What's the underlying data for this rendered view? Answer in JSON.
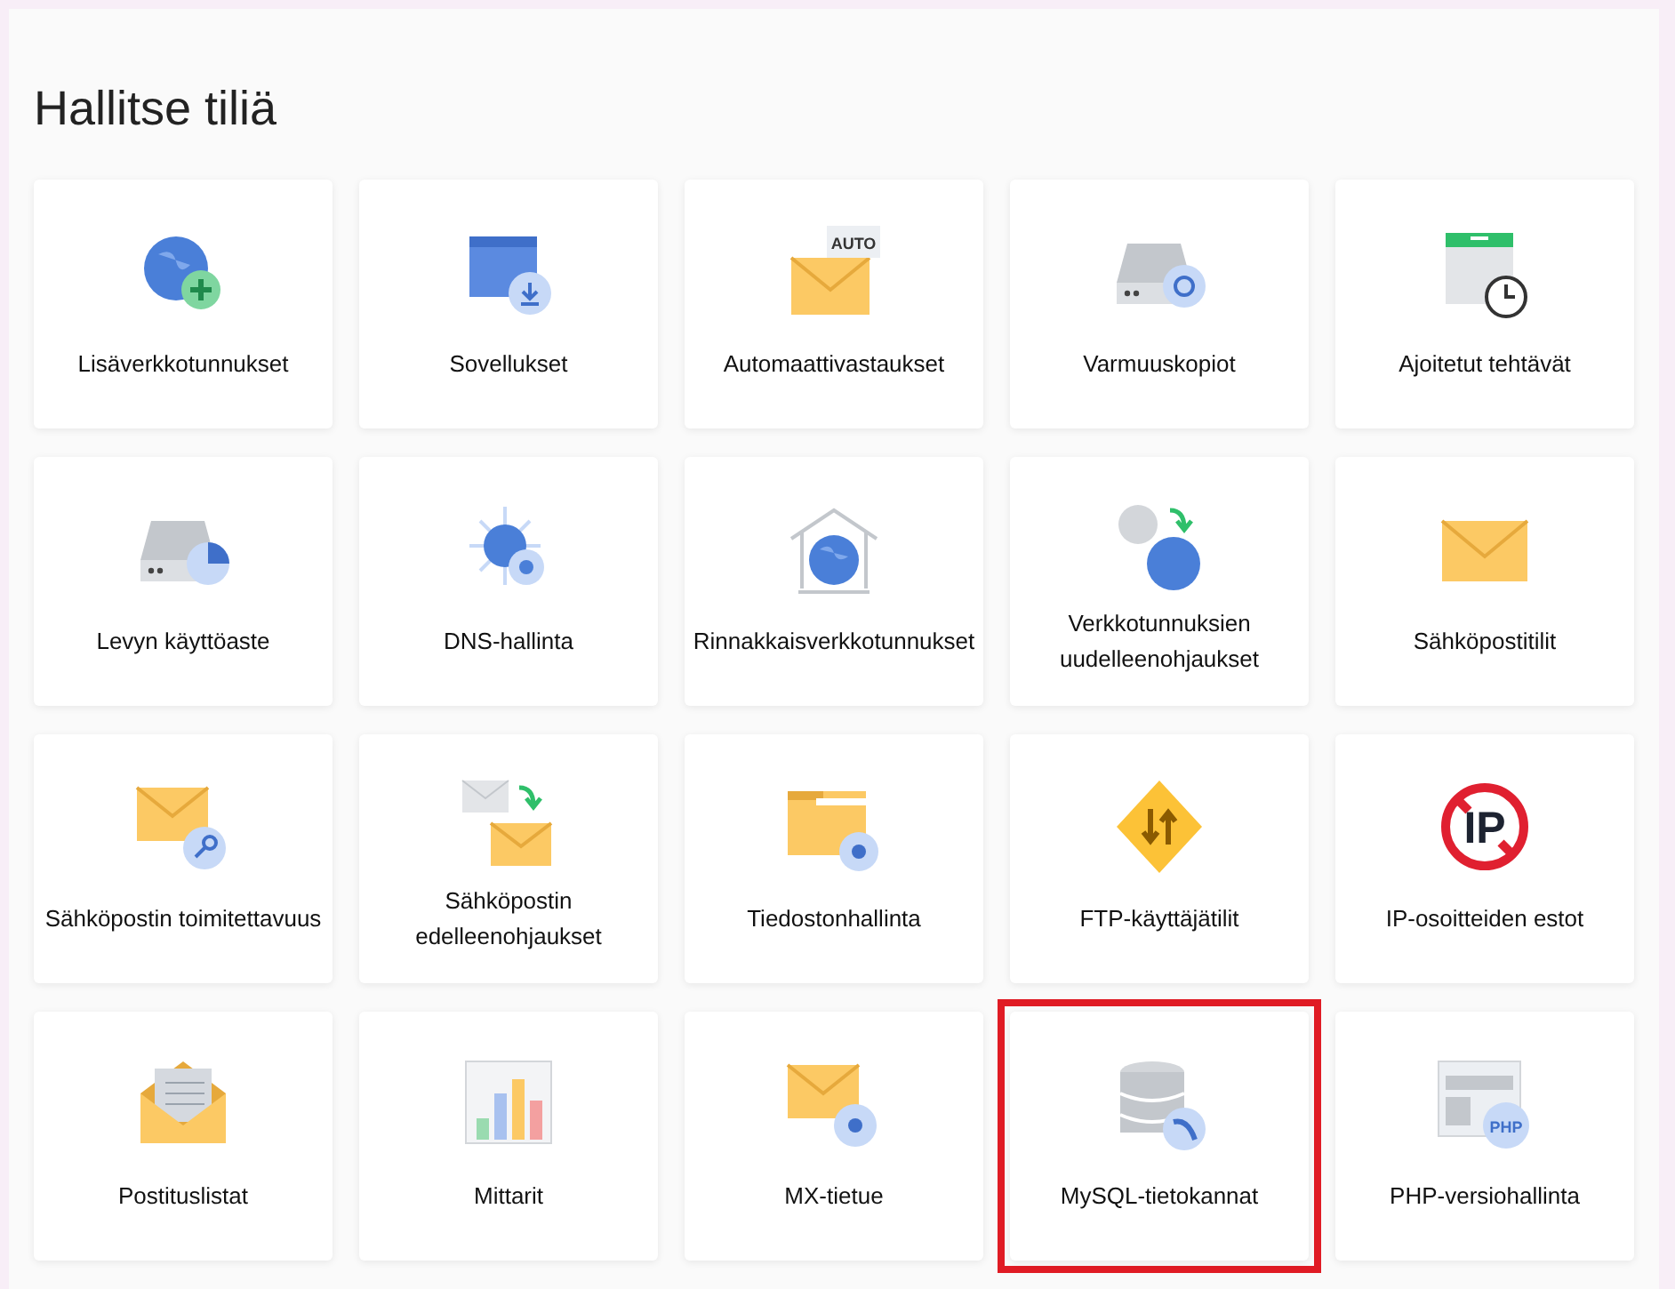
{
  "title": "Hallitse tiliä",
  "tiles": [
    {
      "label": "Lisäverkkotunnukset",
      "highlighted": false
    },
    {
      "label": "Sovellukset",
      "highlighted": false
    },
    {
      "label": "Automaattivastaukset",
      "highlighted": false,
      "icon_text": "AUTO"
    },
    {
      "label": "Varmuuskopiot",
      "highlighted": false
    },
    {
      "label": "Ajoitetut tehtävät",
      "highlighted": false
    },
    {
      "label": "Levyn käyttöaste",
      "highlighted": false
    },
    {
      "label": "DNS-hallinta",
      "highlighted": false
    },
    {
      "label": "Rinnakkaisverkkotunnukset",
      "highlighted": false
    },
    {
      "label": "Verkkotunnuksien uudelleenohjaukset",
      "highlighted": false
    },
    {
      "label": "Sähköpostitilit",
      "highlighted": false
    },
    {
      "label": "Sähköpostin toimitettavuus",
      "highlighted": false
    },
    {
      "label": "Sähköpostin edelleenohjaukset",
      "highlighted": false
    },
    {
      "label": "Tiedostonhallinta",
      "highlighted": false
    },
    {
      "label": "FTP-käyttäjätilit",
      "highlighted": false
    },
    {
      "label": "IP-osoitteiden estot",
      "highlighted": false,
      "icon_text": "IP"
    },
    {
      "label": "Postituslistat",
      "highlighted": false
    },
    {
      "label": "Mittarit",
      "highlighted": false
    },
    {
      "label": "MX-tietue",
      "highlighted": false
    },
    {
      "label": "MySQL-tietokannat",
      "highlighted": true
    },
    {
      "label": "PHP-versiohallinta",
      "highlighted": false,
      "icon_text": "PHP"
    }
  ]
}
